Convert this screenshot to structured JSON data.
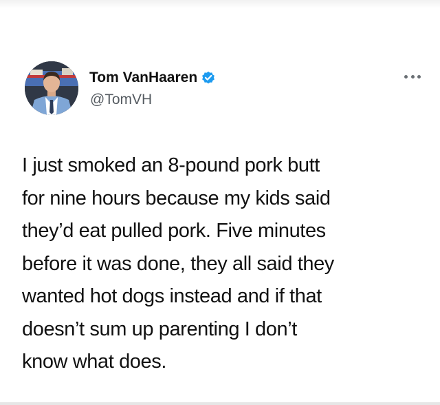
{
  "tweet": {
    "author": {
      "display_name": "Tom VanHaaren",
      "handle": "@TomVH",
      "verified": true,
      "avatar_icon": "profile-photo"
    },
    "more_icon": "ellipsis-icon",
    "text": "I just smoked an 8-pound pork butt\nfor nine hours because my kids said\nthey’d eat pulled pork. Five minutes\nbefore it was done, they all said they\nwanted hot dogs instead and if that\ndoesn’t sum up parenting I don’t\nknow what does."
  },
  "colors": {
    "verified_badge": "#1d9bf0",
    "text": "#111111",
    "handle": "#555b61"
  }
}
